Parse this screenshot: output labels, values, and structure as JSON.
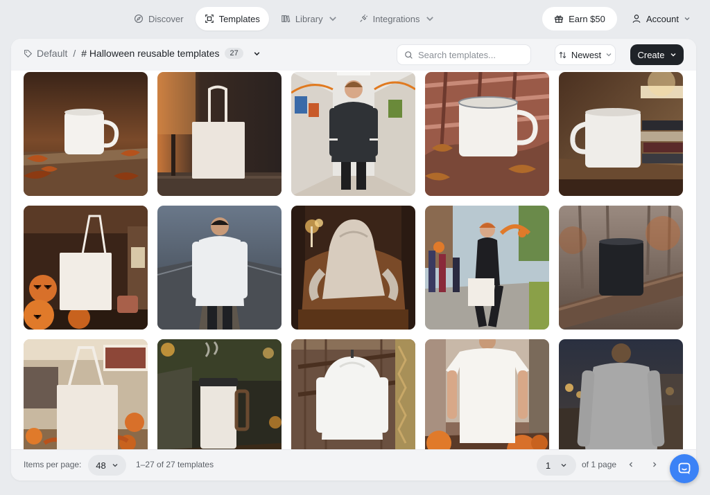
{
  "nav": {
    "items": [
      {
        "label": "Discover",
        "icon": "compass-icon"
      },
      {
        "label": "Templates",
        "icon": "template-frame-icon",
        "active": true
      },
      {
        "label": "Library",
        "icon": "books-icon"
      },
      {
        "label": "Integrations",
        "icon": "plug-icon"
      }
    ],
    "earn_label": "Earn $50",
    "account_label": "Account"
  },
  "toolbar": {
    "breadcrumb_root": "Default",
    "breadcrumb_sep": "/",
    "collection_title": "# Halloween reusable templates",
    "count": "27",
    "search_placeholder": "Search templates...",
    "search_value": "",
    "sort_label": "Newest",
    "create_label": "Create"
  },
  "templates": [
    {
      "item": "white enamel mug on stone ledge with autumn leaves",
      "icon": "mug-icon"
    },
    {
      "item": "blank canvas tote bag on wooden porch at dusk",
      "icon": "tote-icon"
    },
    {
      "item": "girl in dark hoodie in school hallway",
      "icon": "hoodie-icon"
    },
    {
      "item": "white enamel camp mug on plaid blanket",
      "icon": "mug-icon"
    },
    {
      "item": "white mug on wooden tray with books",
      "icon": "mug-icon"
    },
    {
      "item": "white tote bag with jack-o-lanterns",
      "icon": "tote-icon"
    },
    {
      "item": "man in white hoodie on foggy bridge",
      "icon": "hoodie-icon"
    },
    {
      "item": "hoodie draped on antique armchair with candles",
      "icon": "hoodie-icon"
    },
    {
      "item": "woman carrying tote at halloween street fair",
      "icon": "tote-icon"
    },
    {
      "item": "black tumbler on wooden railing in misty forest",
      "icon": "tumbler-icon"
    },
    {
      "item": "canvas tote bag at pumpkin market stall",
      "icon": "tote-icon"
    },
    {
      "item": "white travel mug with steam at night",
      "icon": "tumbler-icon"
    },
    {
      "item": "white hoodie hanging on barn door",
      "icon": "hoodie-icon"
    },
    {
      "item": "woman in white t-shirt carving pumpkins",
      "icon": "tshirt-icon"
    },
    {
      "item": "grey long sleeve shirt back view at dusk",
      "icon": "longsleeve-icon"
    }
  ],
  "footer": {
    "items_per_page_label": "Items per page:",
    "items_per_page_value": "48",
    "range_text": "1–27 of 27 templates",
    "page_value": "1",
    "of_pages_text": "of 1 page"
  },
  "colors": {
    "accent_dark": "#1f2328",
    "chat_blue": "#3b82f6",
    "page_bg": "#e9ebee"
  }
}
